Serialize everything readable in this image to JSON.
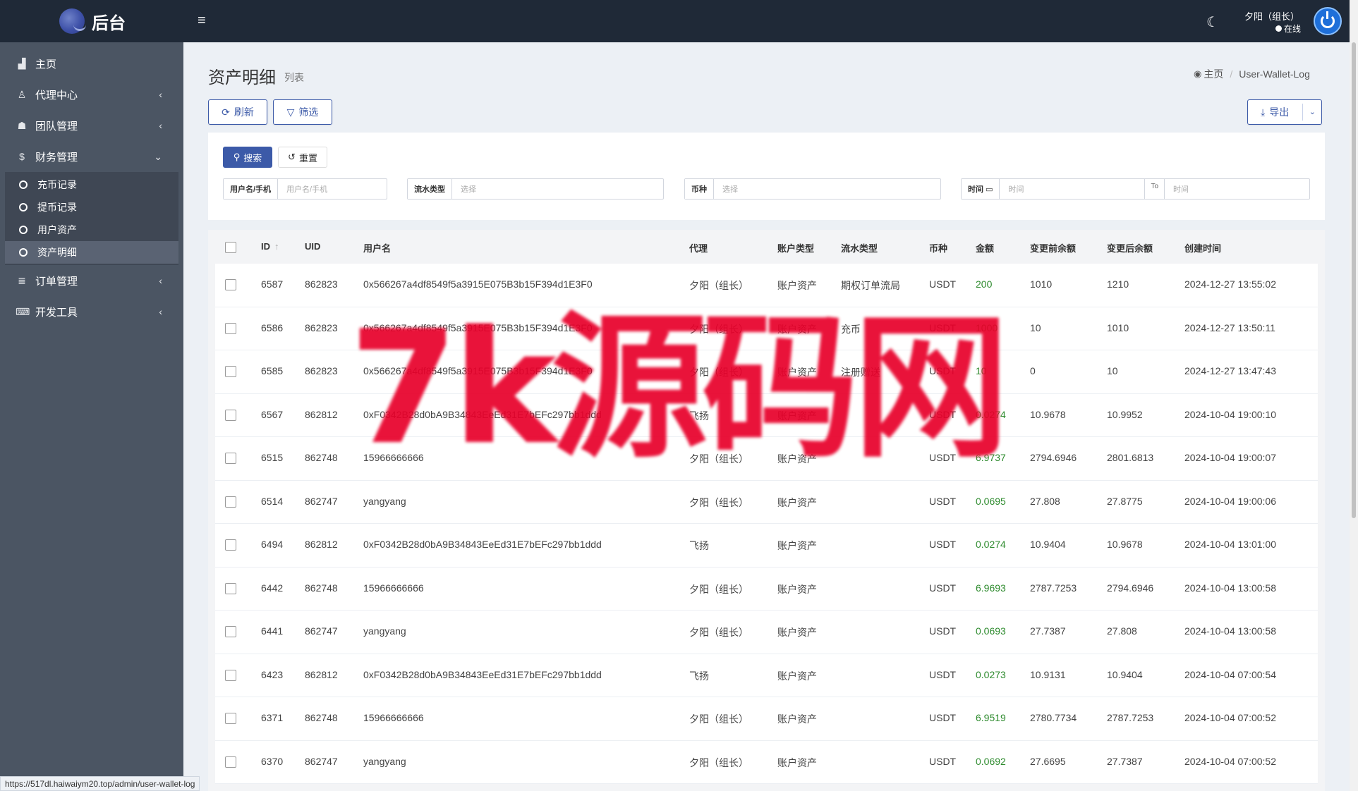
{
  "brand": {
    "title": "后台"
  },
  "sidebar": {
    "items": [
      {
        "label": "主页",
        "icon": "bar-chart-icon",
        "glyph": "▟"
      },
      {
        "label": "代理中心",
        "icon": "user-icon",
        "glyph": "♙"
      },
      {
        "label": "团队管理",
        "icon": "users-icon",
        "glyph": "☗"
      },
      {
        "label": "财务管理",
        "icon": "dollar-icon",
        "glyph": "$"
      },
      {
        "label": "订单管理",
        "icon": "list-icon",
        "glyph": "≣"
      },
      {
        "label": "开发工具",
        "icon": "keyboard-icon",
        "glyph": "⌨"
      }
    ],
    "finance_sub": [
      "充币记录",
      "提币记录",
      "用户资产",
      "资产明细"
    ]
  },
  "topbar": {
    "menu_icon": "≡",
    "theme_icon": "☾",
    "user_name": "夕阳（组长）",
    "user_status": "在线"
  },
  "header": {
    "title": "资产明细",
    "subtitle": "列表",
    "breadcrumb_home": "主页",
    "breadcrumb_current": "User-Wallet-Log"
  },
  "toolbar": {
    "refresh_label": "刷新",
    "filter_label": "筛选",
    "export_label": "导出"
  },
  "filter": {
    "search_label": "搜索",
    "reset_label": "重置",
    "user_label": "用户名/手机",
    "user_placeholder": "用户名/手机",
    "flow_label": "流水类型",
    "flow_placeholder": "选择",
    "coin_label": "币种",
    "coin_placeholder": "选择",
    "time_label": "时间",
    "time_from_placeholder": "时间",
    "time_to_label": "To",
    "time_to_placeholder": "时间"
  },
  "table": {
    "columns": [
      "ID",
      "UID",
      "用户名",
      "代理",
      "账户类型",
      "流水类型",
      "币种",
      "金额",
      "变更前余额",
      "变更后余额",
      "创建时间"
    ],
    "id_sort_icon": "↑",
    "rows": [
      {
        "id": "6587",
        "uid": "862823",
        "username": "0x566267a4df8549f5a3915E075B3b15F394d1E3F0",
        "agent": "夕阳（组长）",
        "account_type": "账户资产",
        "flow_type": "期权订单流局",
        "coin": "USDT",
        "amount": "200",
        "before": "1010",
        "after": "1210",
        "created": "2024-12-27 13:55:02"
      },
      {
        "id": "6586",
        "uid": "862823",
        "username": "0x566267a4df8549f5a3915E075B3b15F394d1E3F0",
        "agent": "夕阳（组长）",
        "account_type": "账户资产",
        "flow_type": "充币",
        "coin": "USDT",
        "amount": "1000",
        "before": "10",
        "after": "1010",
        "created": "2024-12-27 13:50:11"
      },
      {
        "id": "6585",
        "uid": "862823",
        "username": "0x566267a4df8549f5a3915E075B3b15F394d1E3F0",
        "agent": "夕阳（组长）",
        "account_type": "账户资产",
        "flow_type": "注册赠送",
        "coin": "USDT",
        "amount": "10",
        "before": "0",
        "after": "10",
        "created": "2024-12-27 13:47:43"
      },
      {
        "id": "6567",
        "uid": "862812",
        "username": "0xF0342B28d0bA9B34843EeEd31E7bEFc297bb1ddd",
        "agent": "飞扬",
        "account_type": "账户资产",
        "flow_type": "",
        "coin": "USDT",
        "amount": "0.0274",
        "before": "10.9678",
        "after": "10.9952",
        "created": "2024-10-04 19:00:10"
      },
      {
        "id": "6515",
        "uid": "862748",
        "username": "15966666666",
        "agent": "夕阳（组长）",
        "account_type": "账户资产",
        "flow_type": "",
        "coin": "USDT",
        "amount": "6.9737",
        "before": "2794.6946",
        "after": "2801.6813",
        "created": "2024-10-04 19:00:07"
      },
      {
        "id": "6514",
        "uid": "862747",
        "username": "yangyang",
        "agent": "夕阳（组长）",
        "account_type": "账户资产",
        "flow_type": "",
        "coin": "USDT",
        "amount": "0.0695",
        "before": "27.808",
        "after": "27.8775",
        "created": "2024-10-04 19:00:06"
      },
      {
        "id": "6494",
        "uid": "862812",
        "username": "0xF0342B28d0bA9B34843EeEd31E7bEFc297bb1ddd",
        "agent": "飞扬",
        "account_type": "账户资产",
        "flow_type": "",
        "coin": "USDT",
        "amount": "0.0274",
        "before": "10.9404",
        "after": "10.9678",
        "created": "2024-10-04 13:01:00"
      },
      {
        "id": "6442",
        "uid": "862748",
        "username": "15966666666",
        "agent": "夕阳（组长）",
        "account_type": "账户资产",
        "flow_type": "",
        "coin": "USDT",
        "amount": "6.9693",
        "before": "2787.7253",
        "after": "2794.6946",
        "created": "2024-10-04 13:00:58"
      },
      {
        "id": "6441",
        "uid": "862747",
        "username": "yangyang",
        "agent": "夕阳（组长）",
        "account_type": "账户资产",
        "flow_type": "",
        "coin": "USDT",
        "amount": "0.0693",
        "before": "27.7387",
        "after": "27.808",
        "created": "2024-10-04 13:00:58"
      },
      {
        "id": "6423",
        "uid": "862812",
        "username": "0xF0342B28d0bA9B34843EeEd31E7bEFc297bb1ddd",
        "agent": "飞扬",
        "account_type": "账户资产",
        "flow_type": "",
        "coin": "USDT",
        "amount": "0.0273",
        "before": "10.9131",
        "after": "10.9404",
        "created": "2024-10-04 07:00:54"
      },
      {
        "id": "6371",
        "uid": "862748",
        "username": "15966666666",
        "agent": "夕阳（组长）",
        "account_type": "账户资产",
        "flow_type": "",
        "coin": "USDT",
        "amount": "6.9519",
        "before": "2780.7734",
        "after": "2787.7253",
        "created": "2024-10-04 07:00:52"
      },
      {
        "id": "6370",
        "uid": "862747",
        "username": "yangyang",
        "agent": "夕阳（组长）",
        "account_type": "账户资产",
        "flow_type": "",
        "coin": "USDT",
        "amount": "0.0692",
        "before": "27.6695",
        "after": "27.7387",
        "created": "2024-10-04 07:00:52"
      }
    ]
  },
  "watermark": {
    "text": "7k源码网"
  },
  "status_bar": {
    "url": "https://517dl.haiwaiym20.top/admin/user-wallet-log"
  },
  "colors": {
    "primary": "#3c5aa8",
    "sidebar": "#4b5563",
    "topbar": "#1f2937",
    "amount": "#2e8b2e",
    "watermark": "#e8002a"
  }
}
